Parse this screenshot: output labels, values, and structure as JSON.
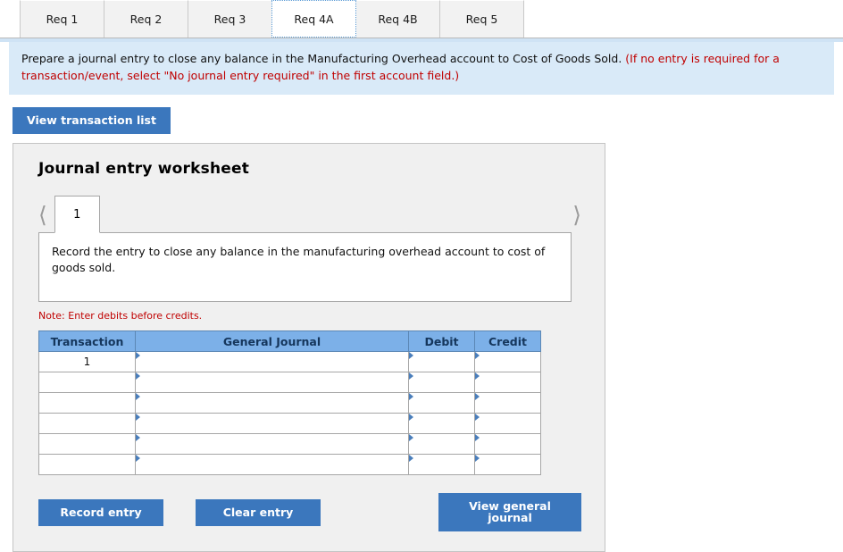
{
  "tabs": [
    {
      "label": "Req 1",
      "active": false
    },
    {
      "label": "Req 2",
      "active": false
    },
    {
      "label": "Req 3",
      "active": false
    },
    {
      "label": "Req 4A",
      "active": true
    },
    {
      "label": "Req 4B",
      "active": false
    },
    {
      "label": "Req 5",
      "active": false
    }
  ],
  "banner": {
    "main_text": "Prepare a journal entry to close any balance in the Manufacturing Overhead account to Cost of Goods Sold.",
    "red_text": "(If no entry is required for a transaction/event, select \"No journal entry required\" in the first account field.)"
  },
  "toolbar": {
    "view_transaction_list_label": "View transaction list"
  },
  "worksheet": {
    "title": "Journal entry worksheet",
    "pager": {
      "prev_icon": "chevron-left-icon",
      "next_icon": "chevron-right-icon",
      "current_page": "1"
    },
    "description": "Record the entry to close any balance in the manufacturing overhead account to cost of goods sold.",
    "note": "Note: Enter debits before credits.",
    "table": {
      "headers": [
        "Transaction",
        "General Journal",
        "Debit",
        "Credit"
      ],
      "rows": [
        {
          "transaction": "1",
          "general_journal": "",
          "debit": "",
          "credit": ""
        },
        {
          "transaction": "",
          "general_journal": "",
          "debit": "",
          "credit": ""
        },
        {
          "transaction": "",
          "general_journal": "",
          "debit": "",
          "credit": ""
        },
        {
          "transaction": "",
          "general_journal": "",
          "debit": "",
          "credit": ""
        },
        {
          "transaction": "",
          "general_journal": "",
          "debit": "",
          "credit": ""
        },
        {
          "transaction": "",
          "general_journal": "",
          "debit": "",
          "credit": ""
        }
      ]
    },
    "buttons": {
      "record_entry": "Record entry",
      "clear_entry": "Clear entry",
      "view_general_journal": "View general journal"
    }
  },
  "colors": {
    "accent_blue": "#3b77bd",
    "header_blue": "#7cb0e8",
    "banner_blue": "#d9eaf8",
    "input_border_blue": "#4a7ebb",
    "note_red": "#c00000",
    "panel_gray": "#f0f0f0"
  }
}
